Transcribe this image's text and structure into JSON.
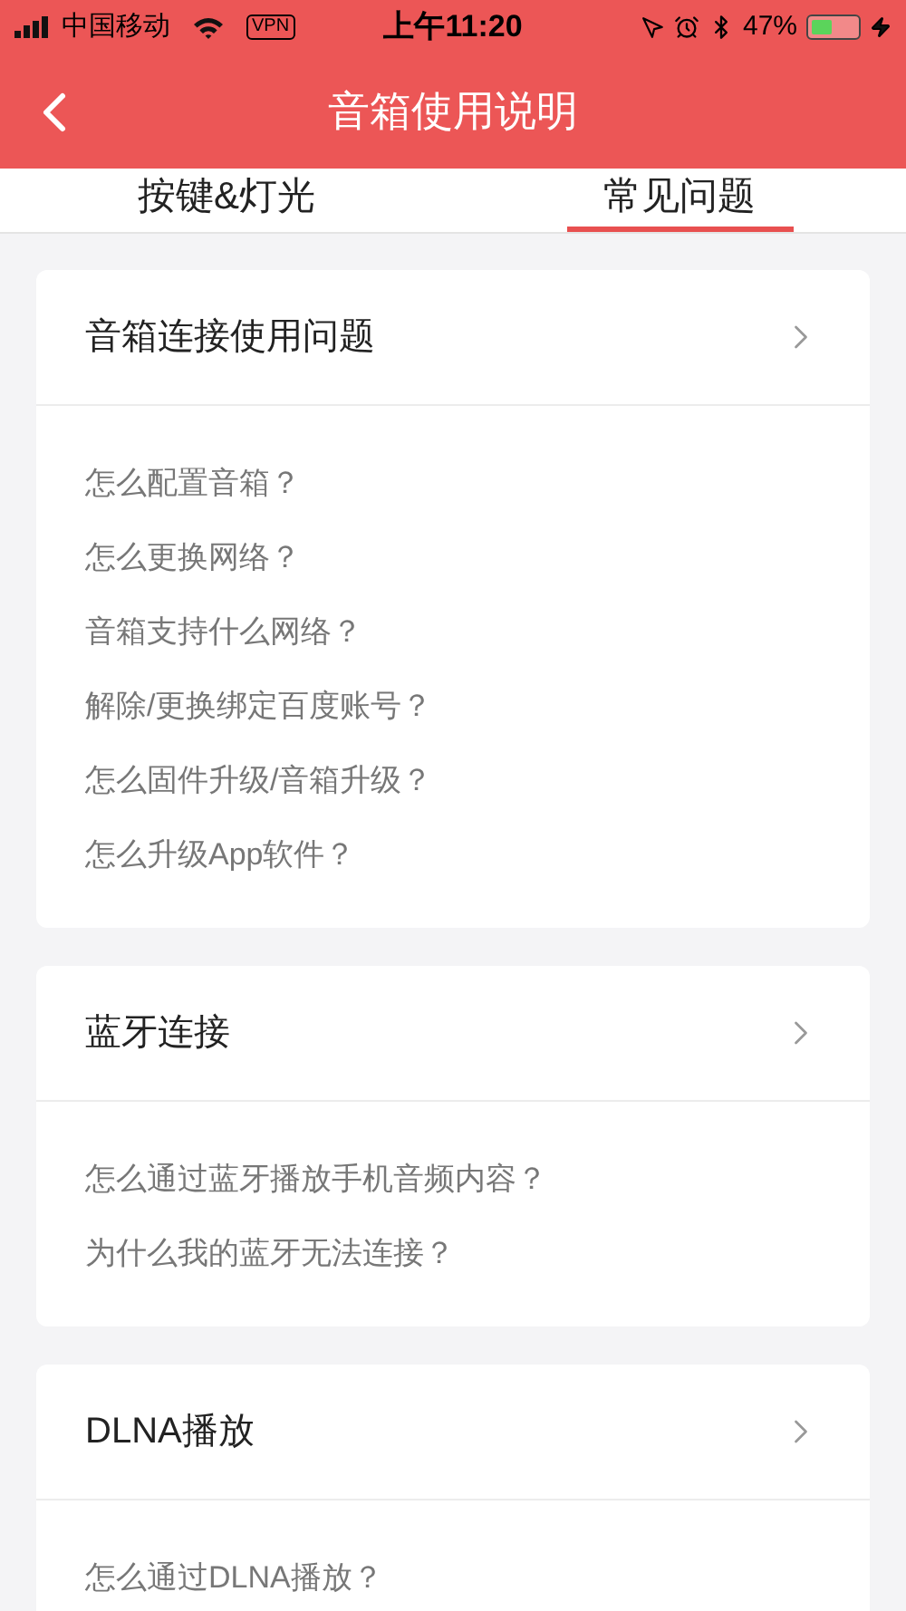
{
  "status_bar": {
    "carrier": "中国移动",
    "vpn": "VPN",
    "time": "上午11:20",
    "battery": "47%"
  },
  "header": {
    "title": "音箱使用说明"
  },
  "tabs": [
    {
      "label": "按键&灯光",
      "selected": false
    },
    {
      "label": "常见问题",
      "selected": true
    }
  ],
  "sections": [
    {
      "title": "音箱连接使用问题",
      "questions": [
        "怎么配置音箱？",
        "怎么更换网络？",
        "音箱支持什么网络？",
        "解除/更换绑定百度账号？",
        "怎么固件升级/音箱升级？",
        "怎么升级App软件？"
      ]
    },
    {
      "title": "蓝牙连接",
      "questions": [
        "怎么通过蓝牙播放手机音频内容？",
        "为什么我的蓝牙无法连接？"
      ]
    },
    {
      "title": "DLNA播放",
      "questions": [
        "怎么通过DLNA播放？"
      ]
    }
  ]
}
